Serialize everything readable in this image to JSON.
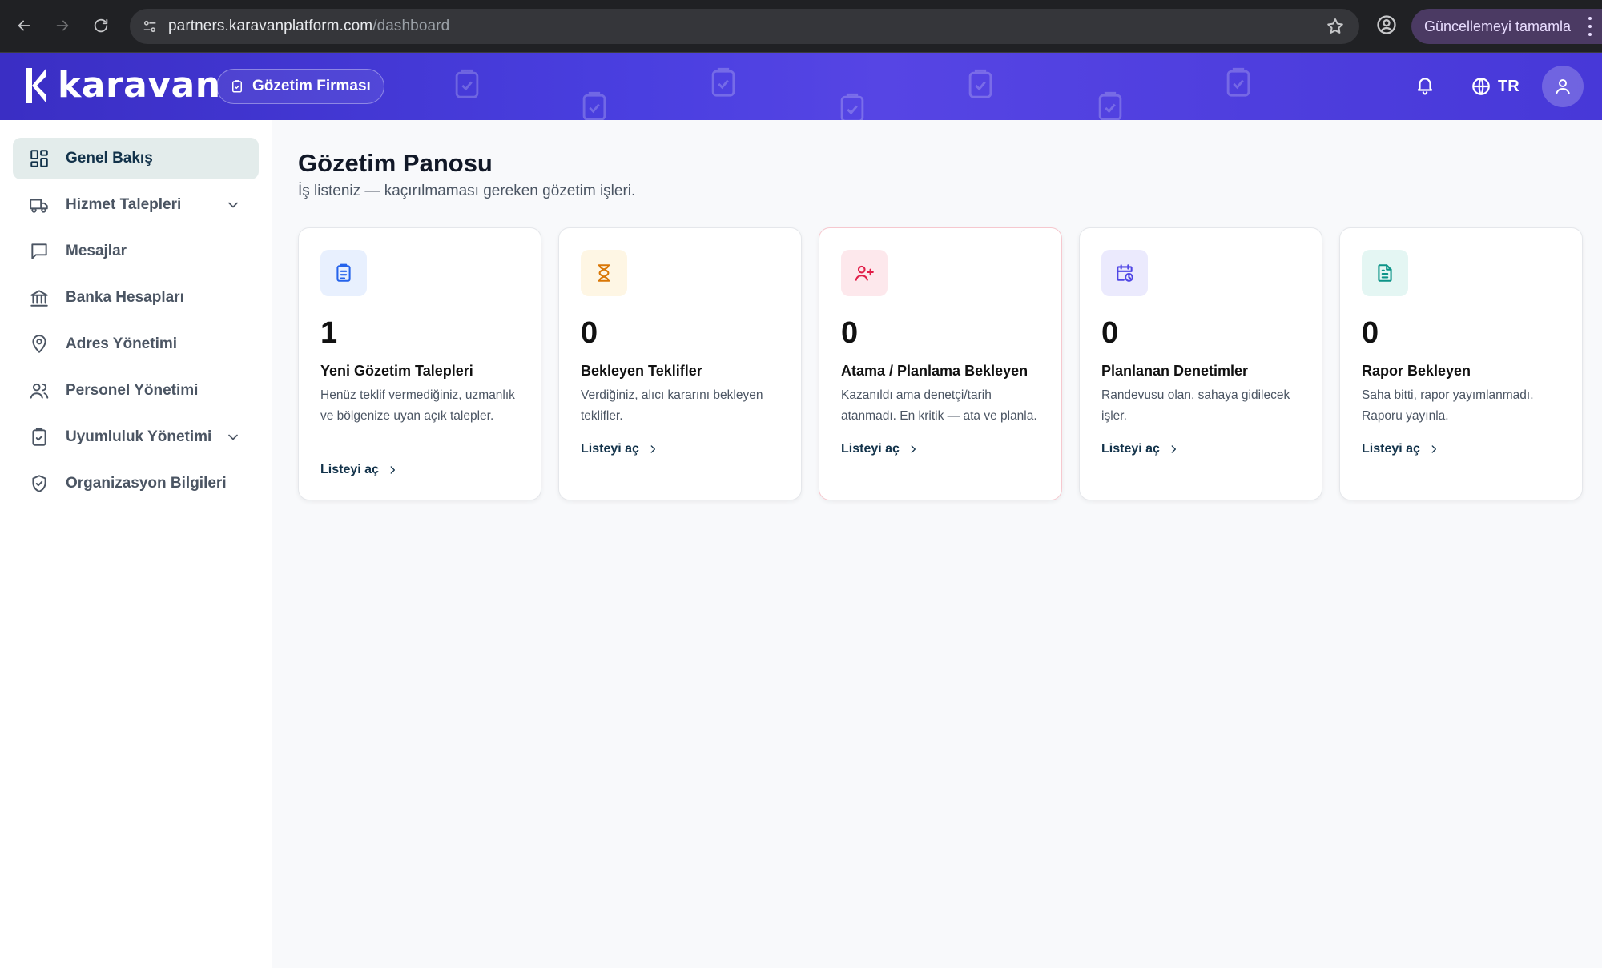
{
  "browser": {
    "url_host": "partners.karavanplatform.com",
    "url_path": "/dashboard",
    "update_button": "Güncellemeyi tamamla"
  },
  "header": {
    "logo_text": "karavan",
    "role_label": "Gözetim Firması",
    "language": "TR",
    "brand_color": "#4a3fe0"
  },
  "sidebar": {
    "items": [
      {
        "label": "Genel Bakış",
        "icon": "grid-icon",
        "active": true
      },
      {
        "label": "Hizmet Talepleri",
        "icon": "truck-icon",
        "expandable": true
      },
      {
        "label": "Mesajlar",
        "icon": "message-icon"
      },
      {
        "label": "Banka Hesapları",
        "icon": "bank-icon"
      },
      {
        "label": "Adres Yönetimi",
        "icon": "map-pin-icon"
      },
      {
        "label": "Personel Yönetimi",
        "icon": "users-icon"
      },
      {
        "label": "Uyumluluk Yönetimi",
        "icon": "clipboard-check-icon",
        "expandable": true
      },
      {
        "label": "Organizasyon Bilgileri",
        "icon": "shield-check-icon"
      }
    ]
  },
  "main": {
    "title": "Gözetim Panosu",
    "subtitle": "İş listeniz — kaçırılmaması gereken gözetim işleri.",
    "cards": [
      {
        "count": "1",
        "title": "Yeni Gözetim Talepleri",
        "desc": "Henüz teklif vermediğiniz, uzmanlık ve bölgenize uyan açık talepler.",
        "link": "Listeyi aç",
        "icon": "clipboard-list-icon",
        "accent": "#2563eb"
      },
      {
        "count": "0",
        "title": "Bekleyen Teklifler",
        "desc": "Verdiğiniz, alıcı kararını bekleyen teklifler.",
        "link": "Listeyi aç",
        "icon": "hourglass-icon",
        "accent": "#d97706"
      },
      {
        "count": "0",
        "title": "Atama / Planlama Bekleyen",
        "desc": "Kazanıldı ama denetçi/tarih atanmadı. En kritik — ata ve planla.",
        "link": "Listeyi aç",
        "icon": "user-plus-icon",
        "accent": "#e11d48"
      },
      {
        "count": "0",
        "title": "Planlanan Denetimler",
        "desc": "Randevusu olan, sahaya gidilecek işler.",
        "link": "Listeyi aç",
        "icon": "calendar-clock-icon",
        "accent": "#4f46e5"
      },
      {
        "count": "0",
        "title": "Rapor Bekleyen",
        "desc": "Saha bitti, rapor yayımlanmadı. Raporu yayınla.",
        "link": "Listeyi aç",
        "icon": "file-text-icon",
        "accent": "#0d9488"
      }
    ]
  }
}
